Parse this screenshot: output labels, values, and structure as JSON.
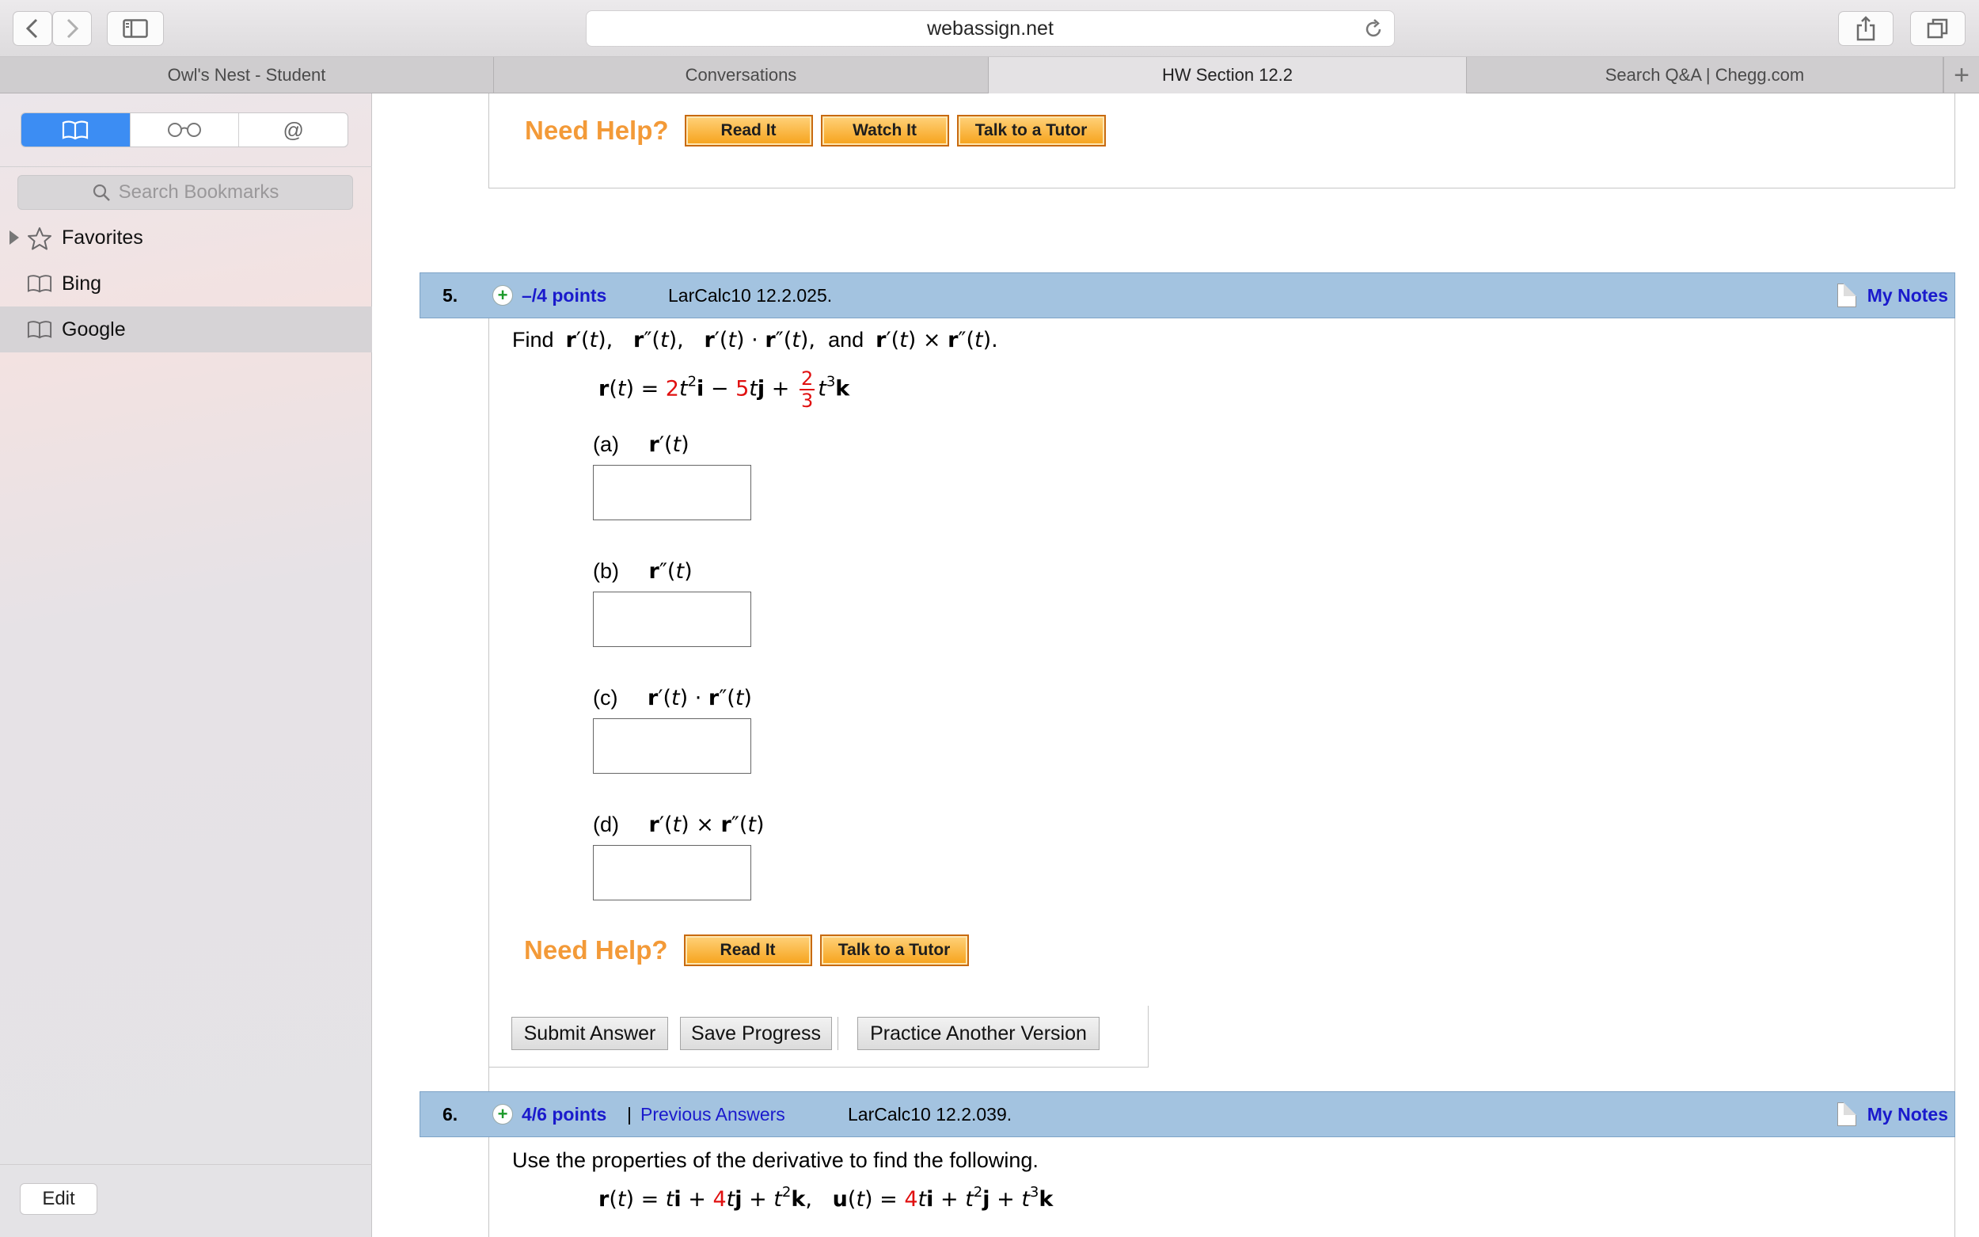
{
  "browser": {
    "url": "webassign.net",
    "tabs": [
      {
        "label": "Owl's Nest - Student",
        "active": false
      },
      {
        "label": "Conversations",
        "active": false
      },
      {
        "label": "HW Section 12.2",
        "active": true
      },
      {
        "label": "Search Q&A | Chegg.com",
        "active": false
      }
    ],
    "new_tab_symbol": "+"
  },
  "sidebar": {
    "segments": [
      "bookmarks-icon",
      "reading-list-icon",
      "shared-links-icon"
    ],
    "shared_symbol": "@",
    "search_placeholder": "Search Bookmarks",
    "items": [
      {
        "label": "Favorites",
        "icon": "star-icon"
      },
      {
        "label": "Bing",
        "icon": "book-icon"
      },
      {
        "label": "Google",
        "icon": "book-icon",
        "selected": true
      }
    ],
    "edit_label": "Edit"
  },
  "help": {
    "need_help": "Need Help?",
    "read_it": "Read It",
    "watch_it": "Watch It",
    "talk_to_tutor": "Talk to a Tutor"
  },
  "q5": {
    "number": "5.",
    "points": "–/4 points",
    "ref": "LarCalc10 12.2.025.",
    "my_notes": "My Notes",
    "find": "Find",
    "and": "and",
    "eq_coef_i": "2",
    "eq_coef_j": "5",
    "eq_frac_num": "2",
    "eq_frac_den": "3",
    "parts": [
      {
        "label": "(a)"
      },
      {
        "label": "(b)"
      },
      {
        "label": "(c)"
      },
      {
        "label": "(d)"
      }
    ]
  },
  "actions": {
    "submit": "Submit Answer",
    "save": "Save Progress",
    "practice": "Practice Another Version"
  },
  "q6": {
    "number": "6.",
    "points": "4/6 points",
    "separator": "|",
    "previous": "Previous Answers",
    "ref": "LarCalc10 12.2.039.",
    "my_notes": "My Notes",
    "text": "Use the properties of the derivative to find the following.",
    "coef_r": "4",
    "coef_u": "4"
  }
}
